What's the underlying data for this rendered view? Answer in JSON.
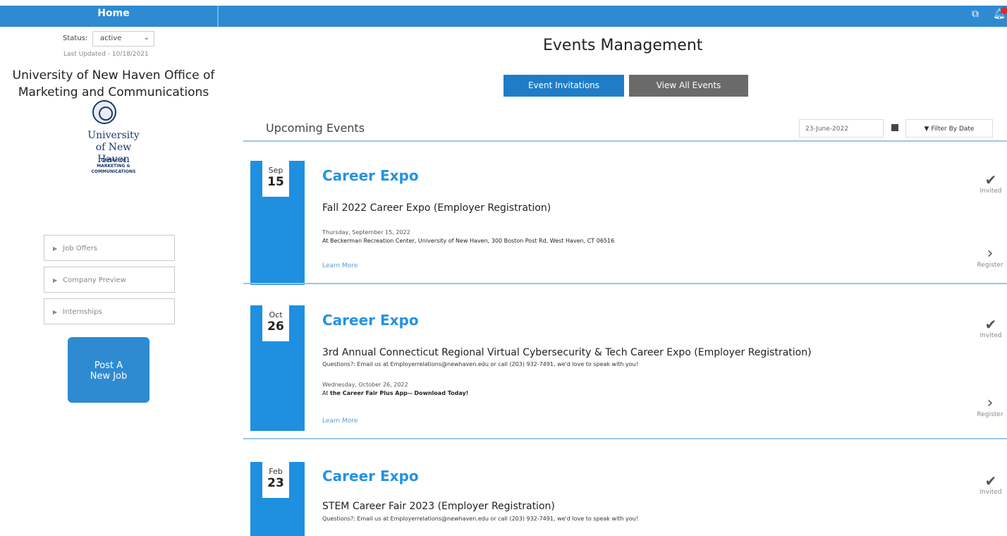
{
  "topbar": {
    "home_label": "Home",
    "icons": [
      "resize-icon",
      "bell-icon"
    ]
  },
  "sidebar": {
    "status_label": "Status:",
    "status_value": "active",
    "last_updated": "Last Updated - 10/18/2021",
    "company_name": "University of New Haven Office of Marketing and Communications",
    "logo_text": "University of New Haven",
    "logo_sub": "OFFICE OF MARKETING & COMMUNICATIONS",
    "menu": [
      {
        "label": "Job Offers"
      },
      {
        "label": "Company Preview"
      },
      {
        "label": "Internships"
      }
    ],
    "post_button": "Post A New Job"
  },
  "main": {
    "title": "Events Management",
    "tab_invitations": "Event Invitations",
    "tab_all": "View All Events",
    "section_title": "Upcoming Events",
    "date_filter_value": "23-June-2022",
    "filter_button": "Filter By Date",
    "events": [
      {
        "month": "Sep",
        "day": "15",
        "title": "Career Expo",
        "name": "Fall 2022 Career Expo (Employer Registration)",
        "question": "",
        "date_text": "Thursday, September 15, 2022",
        "loc_prefix": "At ",
        "location": "Beckerman Recreation Center, University of New Haven, 300 Boston Post Rd, West Haven, CT 06516",
        "learn_more": "Learn More",
        "status": "Invited",
        "register": "Register"
      },
      {
        "month": "Oct",
        "day": "26",
        "title": "Career Expo",
        "name": "3rd Annual Connecticut Regional Virtual Cybersecurity & Tech Career Expo (Employer Registration)",
        "question": "Questions?: Email us at Employerrelations@newhaven.edu or call (203) 932-7491, we'd love to speak with you!",
        "date_text": "Wednesday, October 26, 2022",
        "loc_prefix": "At ",
        "location": "the Career Fair Plus App-- Download Today!",
        "learn_more": "Learn More",
        "status": "Invited",
        "register": "Register"
      },
      {
        "month": "Feb",
        "day": "23",
        "title": "Career Expo",
        "name": "STEM Career Fair 2023 (Employer Registration)",
        "question": "Questions?: Email us at Employerrelations@newhaven.edu or call (203) 932-7491, we'd love to speak with you!",
        "status": "Invited"
      }
    ]
  },
  "colors": {
    "primary": "#2e8ad1",
    "accent_title": "#2593e3",
    "date_column": "#1f8fe0",
    "secondary_button": "#6a6a6a"
  }
}
